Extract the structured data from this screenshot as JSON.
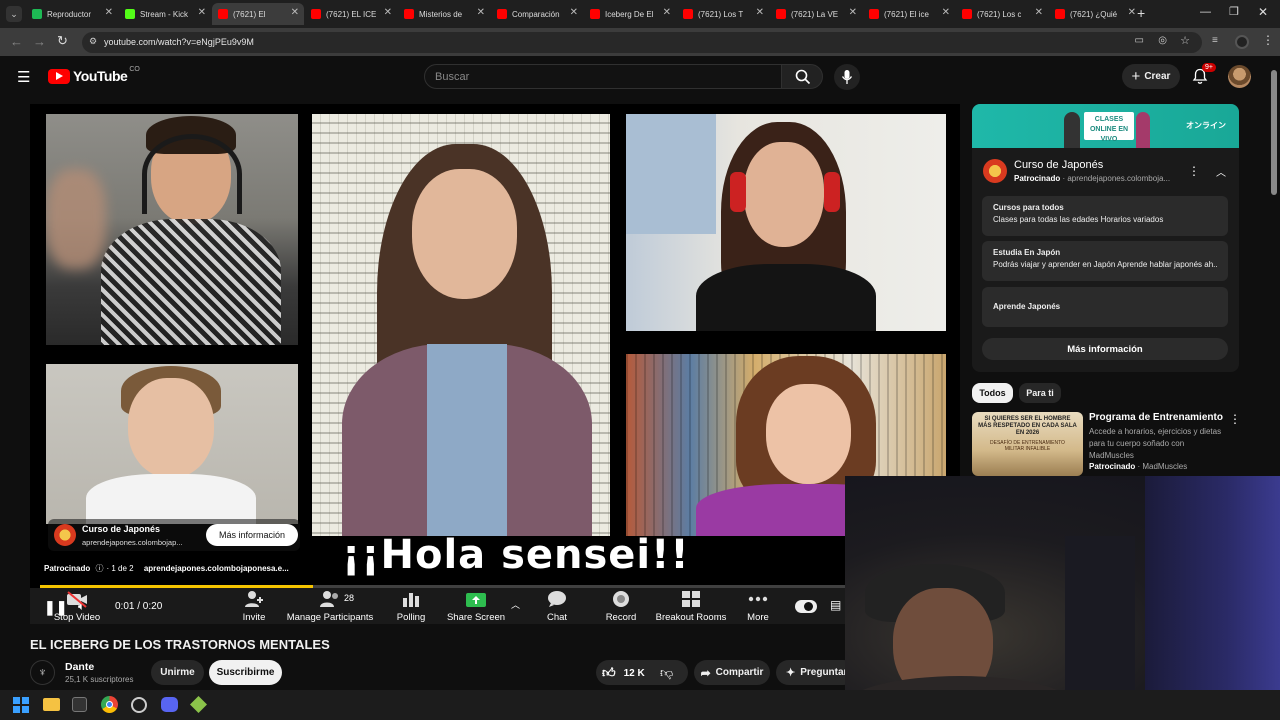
{
  "browser": {
    "tabs": [
      {
        "title": "Reproductor",
        "color": "#1db954",
        "active": false
      },
      {
        "title": "Stream - Kick",
        "color": "#53fc18",
        "active": false
      },
      {
        "title": "(7621) El",
        "color": "#ff0000",
        "active": true
      },
      {
        "title": "(7621) EL ICE",
        "color": "#ff0000",
        "active": false
      },
      {
        "title": "Misterios de",
        "color": "#ff0000",
        "active": false
      },
      {
        "title": "Comparación",
        "color": "#ff0000",
        "active": false
      },
      {
        "title": "Iceberg De El",
        "color": "#ff0000",
        "active": false
      },
      {
        "title": "(7621) Los T",
        "color": "#ff0000",
        "active": false
      },
      {
        "title": "(7621) La VE",
        "color": "#ff0000",
        "active": false
      },
      {
        "title": "(7621) El ice",
        "color": "#ff0000",
        "active": false
      },
      {
        "title": "(7621) Los c",
        "color": "#ff0000",
        "active": false
      },
      {
        "title": "(7621) ¿Quié",
        "color": "#ff0000",
        "active": false
      }
    ],
    "url": "youtube.com/watch?v=eNgjPEu9v9M"
  },
  "youtube": {
    "logo": "YouTube",
    "country": "CO",
    "search_placeholder": "Buscar",
    "create_label": "Crear",
    "notif_badge": "9+"
  },
  "video": {
    "caption": "¡¡Hola sensei!!",
    "time": "0:01 / 0:20",
    "sponsored_label": "Patrocinado",
    "ad_index": "1 de 2",
    "ad_domain": "aprendejapones.colombojaponesa.e...",
    "ad_name": "Curso de Japonés",
    "ad_url": "aprendejapones.colombojap...",
    "ad_button": "Más información",
    "participants_count": "28",
    "zoom_toolbar": [
      {
        "label": "Stop Video",
        "icon": "camera-icon"
      },
      {
        "label": "Invite",
        "icon": "invite-icon"
      },
      {
        "label": "Manage Participants",
        "icon": "participants-icon"
      },
      {
        "label": "Polling",
        "icon": "poll-icon"
      },
      {
        "label": "Share Screen",
        "icon": "share-icon"
      },
      {
        "label": "Chat",
        "icon": "chat-icon"
      },
      {
        "label": "Record",
        "icon": "record-icon"
      },
      {
        "label": "Breakout Rooms",
        "icon": "breakout-icon"
      },
      {
        "label": "More",
        "icon": "more-icon"
      }
    ]
  },
  "sidebar": {
    "banner_text": "CLASES ONLINE EN VIVO",
    "banner_jp": "オンライン",
    "ad_title": "Curso de Japonés",
    "ad_sponsored": "Patrocinado",
    "ad_domain": "aprendejapones.colomboja...",
    "items": [
      {
        "title": "Cursos para todos",
        "desc": "Clases para todas las edades Horarios variados"
      },
      {
        "title": "Estudia En Japón",
        "desc": "Podrás viajar y aprender en Japón Aprende hablar japonés ah..."
      },
      {
        "title": "Aprende Japonés",
        "desc": ""
      }
    ],
    "more_info": "Más información",
    "chips": [
      "Todos",
      "Para ti"
    ],
    "rec": {
      "title": "Programa de Entrenamiento",
      "desc": "Accede a horarios, ejercicios y dietas para tu cuerpo soñado con MadMuscles",
      "sponsored": "Patrocinado",
      "channel": "MadMuscles",
      "thumb_text": "SI QUIERES SER EL HOMBRE MÁS RESPETADO EN CADA SALA EN 2026",
      "thumb_sub": "DESAFÍO DE ENTRENAMIENTO MILITAR INFALIBLE"
    }
  },
  "meta": {
    "video_title": "EL ICEBERG DE LOS TRASTORNOS MENTALES",
    "channel": "Dante",
    "subscribers": "25,1 K suscriptores",
    "join": "Unirme",
    "subscribe": "Suscribirme",
    "likes": "12 K",
    "share": "Compartir",
    "ask": "Preguntar"
  }
}
